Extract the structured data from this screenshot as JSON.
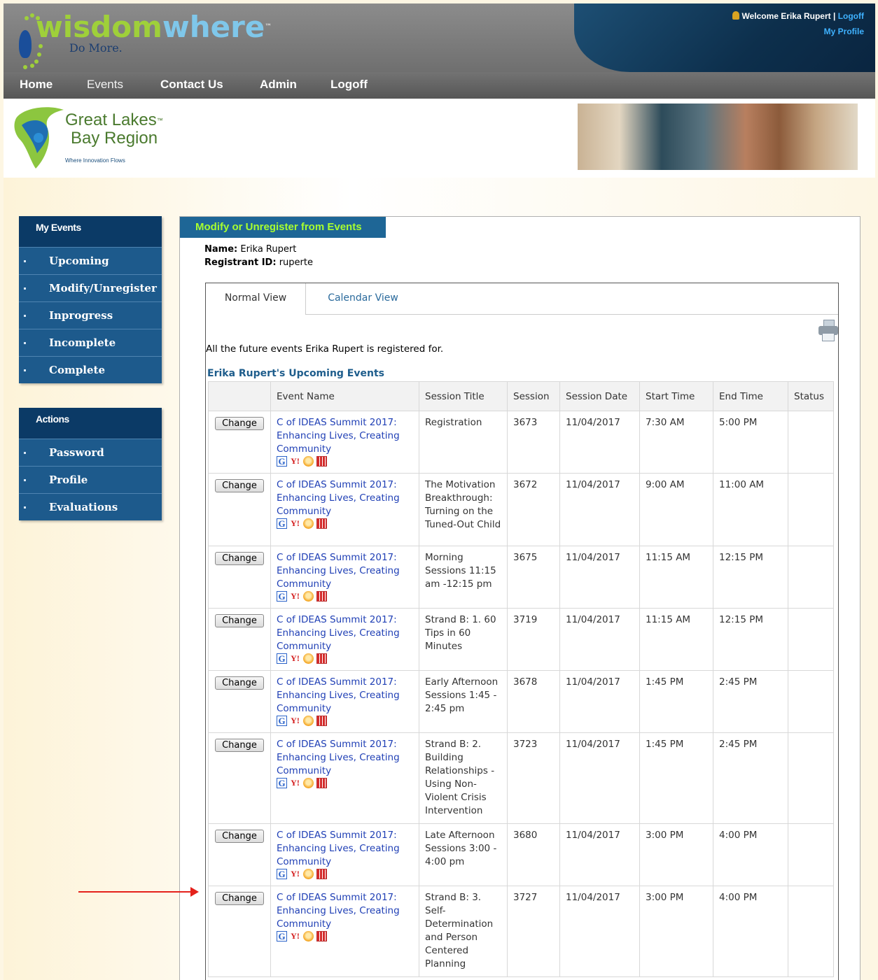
{
  "header": {
    "logo_primary": "wisdom",
    "logo_secondary": "where",
    "logo_tm": "™",
    "tagline": "Do More.",
    "welcome": "Welcome Erika Rupert",
    "separator": "|",
    "logoff_link": "Logoff",
    "profile_link": "My Profile"
  },
  "nav": {
    "items": [
      "Home",
      "Events",
      "Contact Us",
      "Admin",
      "Logoff"
    ]
  },
  "region_logo": {
    "line1": "Great Lakes",
    "line2": "Bay Region",
    "tm": "™",
    "tagline": "Where Innovation Flows"
  },
  "sidebar": {
    "my_events_title": "My Events",
    "my_events": [
      "Upcoming",
      "Modify/Unregister",
      "Inprogress",
      "Incomplete",
      "Complete"
    ],
    "actions_title": "Actions",
    "actions": [
      "Password",
      "Profile",
      "Evaluations"
    ]
  },
  "panel": {
    "title": "Modify or Unregister from Events",
    "name_label": "Name:",
    "name_value": "Erika Rupert",
    "id_label": "Registrant ID:",
    "id_value": "ruperte",
    "tabs": [
      "Normal View",
      "Calendar View"
    ],
    "intro": "All the future events Erika Rupert is registered for.",
    "table_title": "Erika Rupert's Upcoming Events",
    "change_label": "Change"
  },
  "table": {
    "columns": [
      "",
      "Event Name",
      "Session Title",
      "Session",
      "Session Date",
      "Start Time",
      "End Time",
      "Status"
    ],
    "rows": [
      {
        "event": "C of IDEAS Summit 2017: Enhancing Lives, Creating Community",
        "title": "Registration",
        "session": "3673",
        "date": "11/04/2017",
        "start": "7:30 AM",
        "end": "5:00 PM",
        "status": ""
      },
      {
        "event": "C of IDEAS Summit 2017: Enhancing Lives, Creating Community",
        "title": "The Motivation Breakthrough: Turning on the Tuned-Out Child",
        "session": "3672",
        "date": "11/04/2017",
        "start": "9:00 AM",
        "end": "11:00 AM",
        "status": ""
      },
      {
        "event": "C of IDEAS Summit 2017: Enhancing Lives, Creating Community",
        "title": "Morning Sessions 11:15 am -12:15 pm",
        "session": "3675",
        "date": "11/04/2017",
        "start": "11:15 AM",
        "end": "12:15 PM",
        "status": ""
      },
      {
        "event": "C of IDEAS Summit 2017: Enhancing Lives, Creating Community",
        "title": "Strand B: 1. 60 Tips in 60 Minutes",
        "session": "3719",
        "date": "11/04/2017",
        "start": "11:15 AM",
        "end": "12:15 PM",
        "status": ""
      },
      {
        "event": "C of IDEAS Summit 2017: Enhancing Lives, Creating Community",
        "title": "Early Afternoon Sessions 1:45 - 2:45 pm",
        "session": "3678",
        "date": "11/04/2017",
        "start": "1:45 PM",
        "end": "2:45 PM",
        "status": ""
      },
      {
        "event": "C of IDEAS Summit 2017: Enhancing Lives, Creating Community",
        "title": "Strand B: 2. Building Relationships - Using Non-Violent Crisis Intervention",
        "session": "3723",
        "date": "11/04/2017",
        "start": "1:45 PM",
        "end": "2:45 PM",
        "status": ""
      },
      {
        "event": "C of IDEAS Summit 2017: Enhancing Lives, Creating Community",
        "title": "Late Afternoon Sessions 3:00 - 4:00 pm",
        "session": "3680",
        "date": "11/04/2017",
        "start": "3:00 PM",
        "end": "4:00 PM",
        "status": ""
      },
      {
        "event": "C of IDEAS Summit 2017: Enhancing Lives, Creating Community",
        "title": "Strand B: 3. Self-Determination and Person Centered Planning",
        "session": "3727",
        "date": "11/04/2017",
        "start": "3:00 PM",
        "end": "4:00 PM",
        "status": ""
      }
    ]
  },
  "icons": {
    "google_calendar": "G",
    "yahoo_calendar": "Y!"
  },
  "colors": {
    "accent_green": "#a8ff2f",
    "sidebar_blue": "#1d5a8c",
    "link_blue": "#1f3fb5",
    "arrow_red": "#e4211b"
  }
}
